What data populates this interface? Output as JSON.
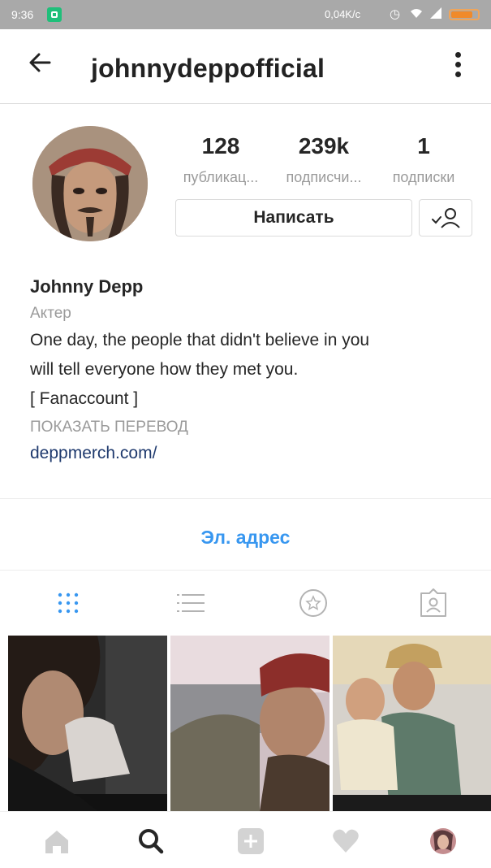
{
  "status_bar": {
    "time": "9:36",
    "net_speed": "0,04K/c",
    "icons": [
      "alarm-icon",
      "wifi-icon",
      "signal-icon",
      "battery-icon"
    ]
  },
  "header": {
    "back_icon": "arrow-left-icon",
    "username": "johnnydeppofficial",
    "more_icon": "more-vertical-icon"
  },
  "profile": {
    "stats": [
      {
        "value": "128",
        "label": "публикац..."
      },
      {
        "value": "239k",
        "label": "подписчи..."
      },
      {
        "value": "1",
        "label": "подписки"
      }
    ],
    "message_button": "Написать",
    "follow_icon": "user-check-icon"
  },
  "bio": {
    "name": "Johnny Depp",
    "category": "Актер",
    "line1": "One day, the people that didn't believe in you",
    "line2": "will tell everyone how they met you.",
    "line3": "[ Fanaccount ]",
    "translate": "ПОКАЗАТЬ ПЕРЕВОД",
    "link": "deppmerch.com/"
  },
  "contact": {
    "email_label": "Эл. адрес"
  },
  "tabs": [
    {
      "icon": "grid-icon",
      "active": true
    },
    {
      "icon": "list-icon",
      "active": false
    },
    {
      "icon": "star-circle-icon",
      "active": false
    },
    {
      "icon": "tagged-user-icon",
      "active": false
    }
  ],
  "colors": {
    "accent": "#3897f0",
    "link": "#1f3a6e",
    "muted": "#9a9a9a",
    "status_bar": "#a9a9a9"
  },
  "bottom_nav": [
    "home-icon",
    "search-icon",
    "add-icon",
    "heart-icon",
    "profile-avatar-icon"
  ]
}
